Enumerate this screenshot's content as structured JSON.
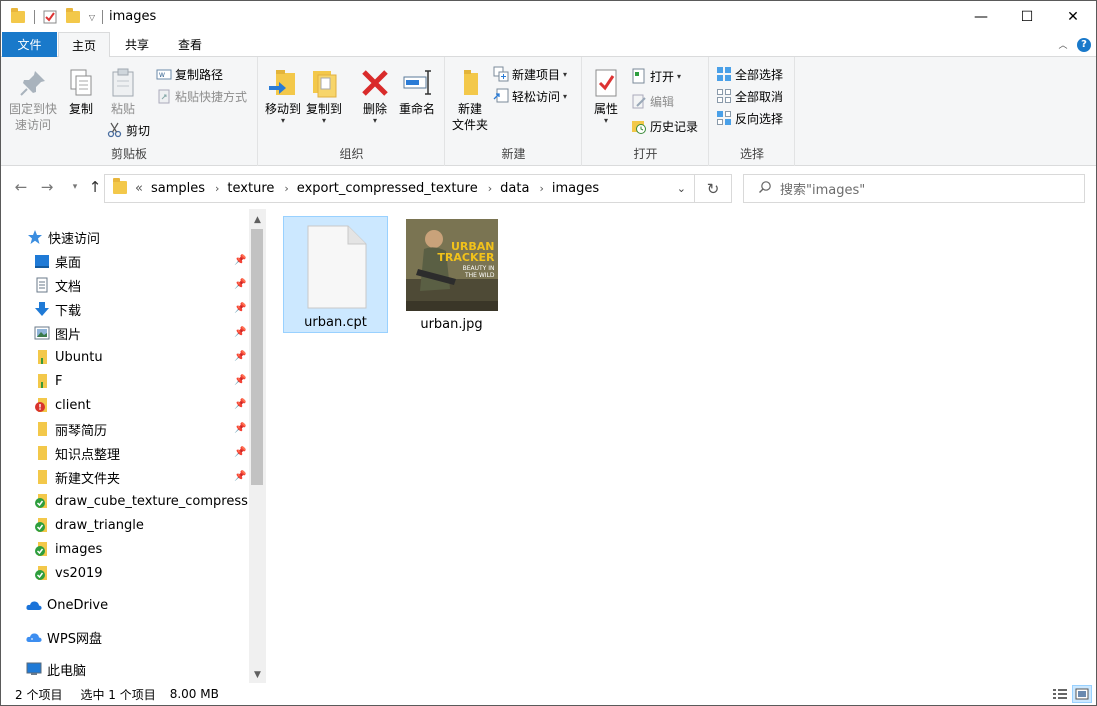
{
  "window": {
    "title": "images",
    "minimize_glyph": "—",
    "maximize_glyph": "☐",
    "close_glyph": "✕"
  },
  "ribbon_tabs": [
    "文件",
    "主页",
    "共享",
    "查看"
  ],
  "ribbon": {
    "clipboard": {
      "title": "剪贴板",
      "pin_quick_access": [
        "固定到快",
        "速访问"
      ],
      "copy": "复制",
      "paste": "粘贴",
      "copy_path": "复制路径",
      "paste_shortcut": "粘贴快捷方式",
      "cut": "剪切"
    },
    "organize": {
      "title": "组织",
      "move_to": "移动到",
      "copy_to": "复制到",
      "delete": "删除",
      "rename": "重命名"
    },
    "new": {
      "title": "新建",
      "new_folder": [
        "新建",
        "文件夹"
      ],
      "new_item": "新建项目",
      "easy_access": "轻松访问"
    },
    "open": {
      "title": "打开",
      "properties": "属性",
      "open": "打开",
      "edit": "编辑",
      "history": "历史记录"
    },
    "select": {
      "title": "选择",
      "select_all": "全部选择",
      "select_none": "全部取消",
      "invert": "反向选择"
    }
  },
  "address": {
    "overflow": "«",
    "crumbs": [
      "samples",
      "texture",
      "export_compressed_texture",
      "data",
      "images"
    ],
    "search_placeholder": "搜索\"images\""
  },
  "nav": {
    "quick_access": "快速访问",
    "items": [
      {
        "label": "桌面",
        "icon": "desktop-icon",
        "pinned": true
      },
      {
        "label": "文档",
        "icon": "documents-icon",
        "pinned": true
      },
      {
        "label": "下载",
        "icon": "download-icon",
        "pinned": true
      },
      {
        "label": "图片",
        "icon": "pictures-icon",
        "pinned": true
      },
      {
        "label": "Ubuntu",
        "icon": "folder-icon",
        "pinned": true
      },
      {
        "label": "F",
        "icon": "folder-icon",
        "pinned": true
      },
      {
        "label": "client",
        "icon": "folder-error-icon",
        "pinned": true
      },
      {
        "label": "丽琴简历",
        "icon": "folder-icon",
        "pinned": true
      },
      {
        "label": "知识点整理",
        "icon": "folder-icon",
        "pinned": true
      },
      {
        "label": "新建文件夹",
        "icon": "folder-icon",
        "pinned": true
      },
      {
        "label": "draw_cube_texture_compress",
        "icon": "folder-synced-icon",
        "pinned": false
      },
      {
        "label": "draw_triangle",
        "icon": "folder-synced-icon",
        "pinned": false
      },
      {
        "label": "images",
        "icon": "folder-synced-icon",
        "pinned": false
      },
      {
        "label": "vs2019",
        "icon": "folder-synced-icon",
        "pinned": false
      }
    ],
    "onedrive": "OneDrive",
    "wps": "WPS网盘",
    "this_pc": "此电脑"
  },
  "files": [
    {
      "name": "urban.cpt",
      "type": "blank-file",
      "selected": true
    },
    {
      "name": "urban.jpg",
      "type": "image",
      "selected": false,
      "thumb_text": [
        "URBAN",
        "TRACKER",
        "BEAUTY IN",
        "THE WILD"
      ]
    }
  ],
  "status": {
    "count": "2 个项目",
    "selection": "选中 1 个项目",
    "size": "8.00 MB"
  },
  "colors": {
    "accent": "#1979ca",
    "selection": "#cce8ff",
    "folder": "#f3c84a"
  }
}
